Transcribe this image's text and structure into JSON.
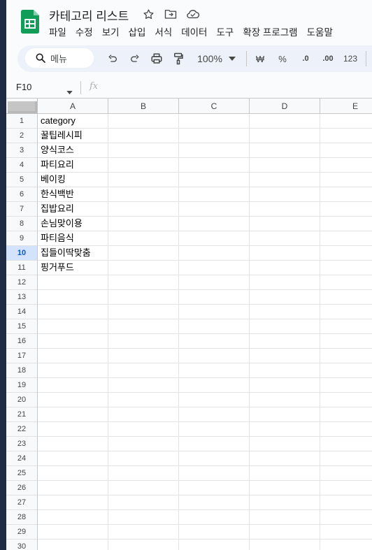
{
  "doc": {
    "title": "카테고리 리스트",
    "menus": [
      "파일",
      "수정",
      "보기",
      "삽입",
      "서식",
      "데이터",
      "도구",
      "확장 프로그램",
      "도움말"
    ]
  },
  "toolbar": {
    "search_placeholder": "메뉴",
    "zoom": "100%",
    "currency": "₩",
    "percent": "%",
    "dec_decrease": ".0",
    "dec_increase": ".00",
    "number_format": "123"
  },
  "formula_bar": {
    "cell_ref": "F10",
    "fx": "fx",
    "value": ""
  },
  "sheet": {
    "columns": [
      "A",
      "B",
      "C",
      "D",
      "E"
    ],
    "rows": [
      "1",
      "2",
      "3",
      "4",
      "5",
      "6",
      "7",
      "8",
      "9",
      "10",
      "11",
      "12",
      "13",
      "14",
      "15",
      "16",
      "17",
      "18",
      "19",
      "20",
      "21",
      "22",
      "23",
      "24",
      "25",
      "26",
      "27",
      "28",
      "29",
      "30"
    ],
    "selected_row": "10",
    "cells_a": [
      "category",
      "꿀팁레시피",
      "양식코스",
      "파티요리",
      "베이킹",
      "한식백반",
      "집밥요리",
      "손님맞이용",
      "파티음식",
      "집들이딱맞춤",
      "핑거푸드"
    ]
  },
  "colors": {
    "sheets_green": "#0f9d58",
    "selected_header": "#d3e3fd",
    "accent": "#0b57d0"
  }
}
